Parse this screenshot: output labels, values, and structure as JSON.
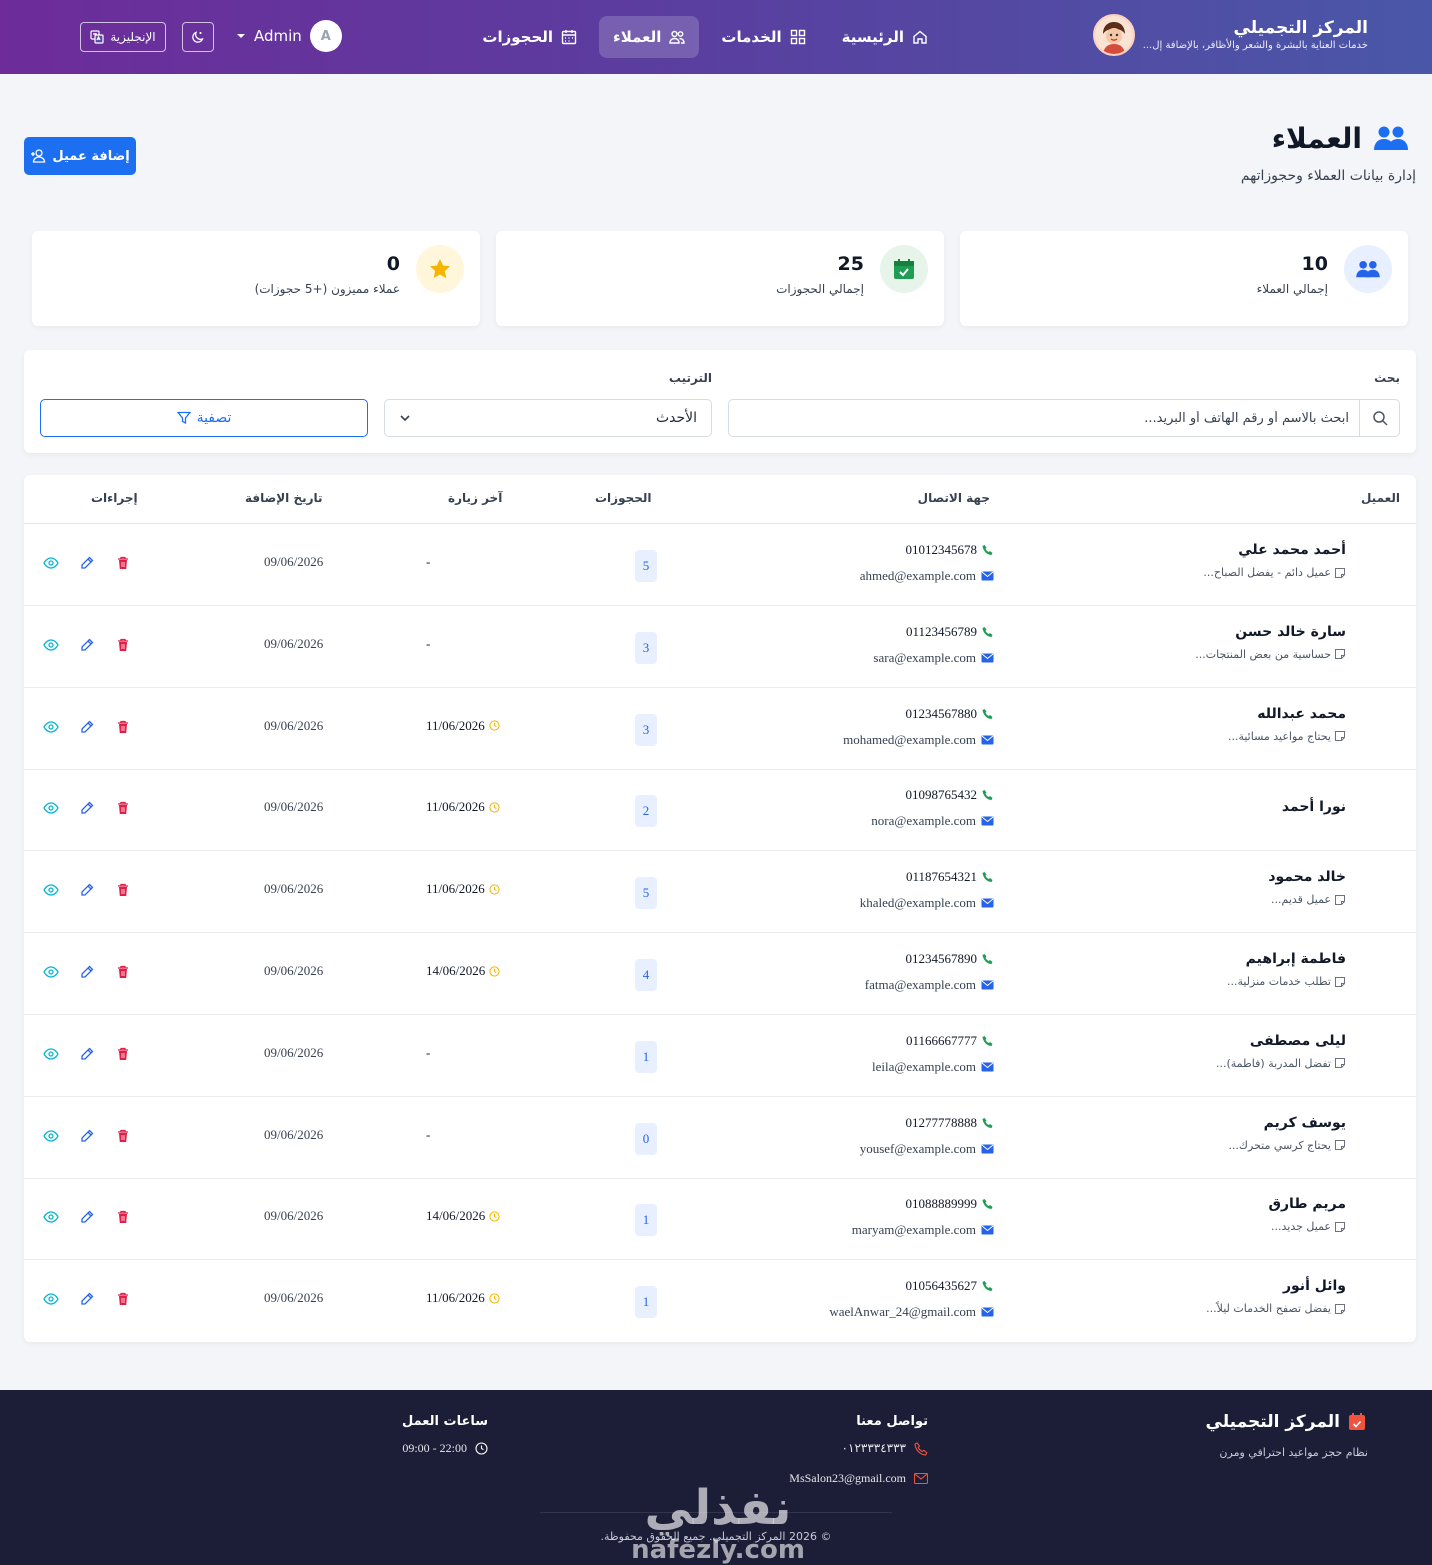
{
  "header": {
    "brand_name": "المركز التجميلي",
    "brand_tagline": "خدمات العناية بالبشرة والشعر والأظافر، بالإضافة إل...",
    "nav": [
      {
        "label": "الرئيسية",
        "icon": "home-icon"
      },
      {
        "label": "الخدمات",
        "icon": "grid-icon"
      },
      {
        "label": "العملاء",
        "icon": "users-icon",
        "active": true
      },
      {
        "label": "الحجوزات",
        "icon": "calendar-icon"
      }
    ],
    "user_initial": "A",
    "user_name": "Admin",
    "language_label": "الإنجليزية"
  },
  "page": {
    "title": "العملاء",
    "subtitle": "إدارة بيانات العملاء وحجوزاتهم",
    "add_button": "إضافة عميل"
  },
  "stats": [
    {
      "value": "10",
      "label": "إجمالي العملاء",
      "icon": "users-icon",
      "color": "#2563eb"
    },
    {
      "value": "25",
      "label": "إجمالي الحجوزات",
      "icon": "calendar-check-icon",
      "color": "#1f9d55"
    },
    {
      "value": "0",
      "label": "عملاء مميزون (+5 حجوزات)",
      "icon": "star-icon",
      "color": "#f5b400"
    }
  ],
  "filters": {
    "search_label": "بحث",
    "search_placeholder": "ابحث بالاسم أو رقم الهاتف أو البريد...",
    "sort_label": "الترتيب",
    "sort_value": "الأحدث",
    "filter_button": "تصفية"
  },
  "table": {
    "headers": {
      "client": "العميل",
      "contact": "جهة الاتصال",
      "bookings": "الحجوزات",
      "last_visit": "آخر زيارة",
      "added": "تاريخ الإضافة",
      "actions": "إجراءات"
    },
    "rows": [
      {
        "name": "أحمد محمد علي",
        "note": "عميل دائم - يفضل الصباح...",
        "phone": "01012345678",
        "email": "ahmed@example.com",
        "bookings": "5",
        "last_visit": "-",
        "added": "09/06/2026"
      },
      {
        "name": "سارة خالد حسن",
        "note": "حساسية من بعض المنتجات...",
        "phone": "01123456789",
        "email": "sara@example.com",
        "bookings": "3",
        "last_visit": "-",
        "added": "09/06/2026"
      },
      {
        "name": "محمد عبدالله",
        "note": "يحتاج مواعيد مسائية...",
        "phone": "01234567880",
        "email": "mohamed@example.com",
        "bookings": "3",
        "last_visit": "11/06/2026",
        "added": "09/06/2026"
      },
      {
        "name": "نورا أحمد",
        "note": "",
        "phone": "01098765432",
        "email": "nora@example.com",
        "bookings": "2",
        "last_visit": "11/06/2026",
        "added": "09/06/2026"
      },
      {
        "name": "خالد محمود",
        "note": "عميل قديم...",
        "phone": "01187654321",
        "email": "khaled@example.com",
        "bookings": "5",
        "last_visit": "11/06/2026",
        "added": "09/06/2026"
      },
      {
        "name": "فاطمة إبراهيم",
        "note": "تطلب خدمات منزلية...",
        "phone": "01234567890",
        "email": "fatma@example.com",
        "bookings": "4",
        "last_visit": "14/06/2026",
        "added": "09/06/2026"
      },
      {
        "name": "ليلى مصطفى",
        "note": "تفضل المدربة (فاطمة)...",
        "phone": "01166667777",
        "email": "leila@example.com",
        "bookings": "1",
        "last_visit": "-",
        "added": "09/06/2026"
      },
      {
        "name": "يوسف كريم",
        "note": "يحتاج كرسي متحرك...",
        "phone": "01277778888",
        "email": "yousef@example.com",
        "bookings": "0",
        "last_visit": "-",
        "added": "09/06/2026"
      },
      {
        "name": "مريم طارق",
        "note": "عميل جديد...",
        "phone": "01088889999",
        "email": "maryam@example.com",
        "bookings": "1",
        "last_visit": "14/06/2026",
        "added": "09/06/2026"
      },
      {
        "name": "وائل أنور",
        "note": "يفضل تصفح الخدمات ليلاً...",
        "phone": "01056435627",
        "email": "waelAnwar_24@gmail.com",
        "bookings": "1",
        "last_visit": "11/06/2026",
        "added": "09/06/2026"
      }
    ]
  },
  "footer": {
    "brand_name": "المركز التجميلي",
    "tagline": "نظام حجز مواعيد احترافي ومرن",
    "contact_title": "تواصل معنا",
    "phone": "٠١٢٣٣٣٤٣٣٣",
    "email": "MsSalon23@gmail.com",
    "hours_title": "ساعات العمل",
    "hours": "22:00 - 09:00",
    "copyright": "© 2026 المركز التجميلي. جميع الحقوق محفوظة."
  },
  "watermark": {
    "text_ar": "نفذلي",
    "text_en": "nafezly.com"
  }
}
